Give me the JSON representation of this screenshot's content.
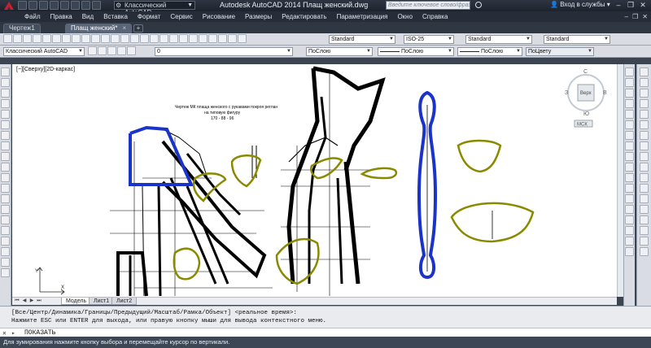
{
  "titlebar": {
    "workspace": "Классический AutoCAD",
    "app_title": "Autodesk AutoCAD 2014    Плащ женский.dwg",
    "search_placeholder": "Введите ключевое слово/фразу",
    "login": "Вход в службы"
  },
  "menu": {
    "items": [
      "Файл",
      "Правка",
      "Вид",
      "Вставка",
      "Формат",
      "Сервис",
      "Рисование",
      "Размеры",
      "Редактировать",
      "Параметризация",
      "Окно",
      "Справка"
    ]
  },
  "tabs": [
    {
      "label": "Чертеж1",
      "active": false
    },
    {
      "label": "Плащ женский*",
      "active": true
    }
  ],
  "toolbar1": {
    "text_style": "Standard",
    "dim_style": "ISO-25",
    "table_style": "Standard",
    "mleader_style": "Standard"
  },
  "toolbar2": {
    "workspace": "Классический AutoCAD",
    "layer": "0",
    "color": "ПоСлою",
    "linetype": "ПоСлою",
    "lineweight": "ПоСлою",
    "plotstyle": "ПоЦвету"
  },
  "viewport": {
    "label": "[−][Сверху][2D-каркас]"
  },
  "drawing": {
    "note_line1": "Чертеж МК плаща женского с рукавами покроя реглан",
    "note_line2": "на типовую фигуру",
    "note_line3": "170 - 88 - 96",
    "ucs_x": "X",
    "ucs_y": "Y"
  },
  "viewcube": {
    "north": "С",
    "south": "Ю",
    "east": "В",
    "west": "З",
    "top_face": "Верх",
    "ucs": "МСК"
  },
  "layout_tabs": [
    {
      "label": "Модель",
      "active": true
    },
    {
      "label": "Лист1",
      "active": false
    },
    {
      "label": "Лист2",
      "active": false
    }
  ],
  "command": {
    "history_line1": "[Все/Центр/Динамика/Границы/Предыдущий/Масштаб/Рамка/Объект] <реальное время>:",
    "history_line2": "Нажмите ESC или ENTER для выхода, или правую кнопку мыши для вывода контекстного меню.",
    "prompt": "ПОКАЗАТЬ"
  },
  "status": {
    "text": "Для зумирования нажмите кнопку выбора и перемещайте курсор по вертикали."
  },
  "colors": {
    "pattern_blue": "#1a33c8",
    "pattern_olive": "#8a8a00",
    "canvas_bg": "#ffffff"
  }
}
